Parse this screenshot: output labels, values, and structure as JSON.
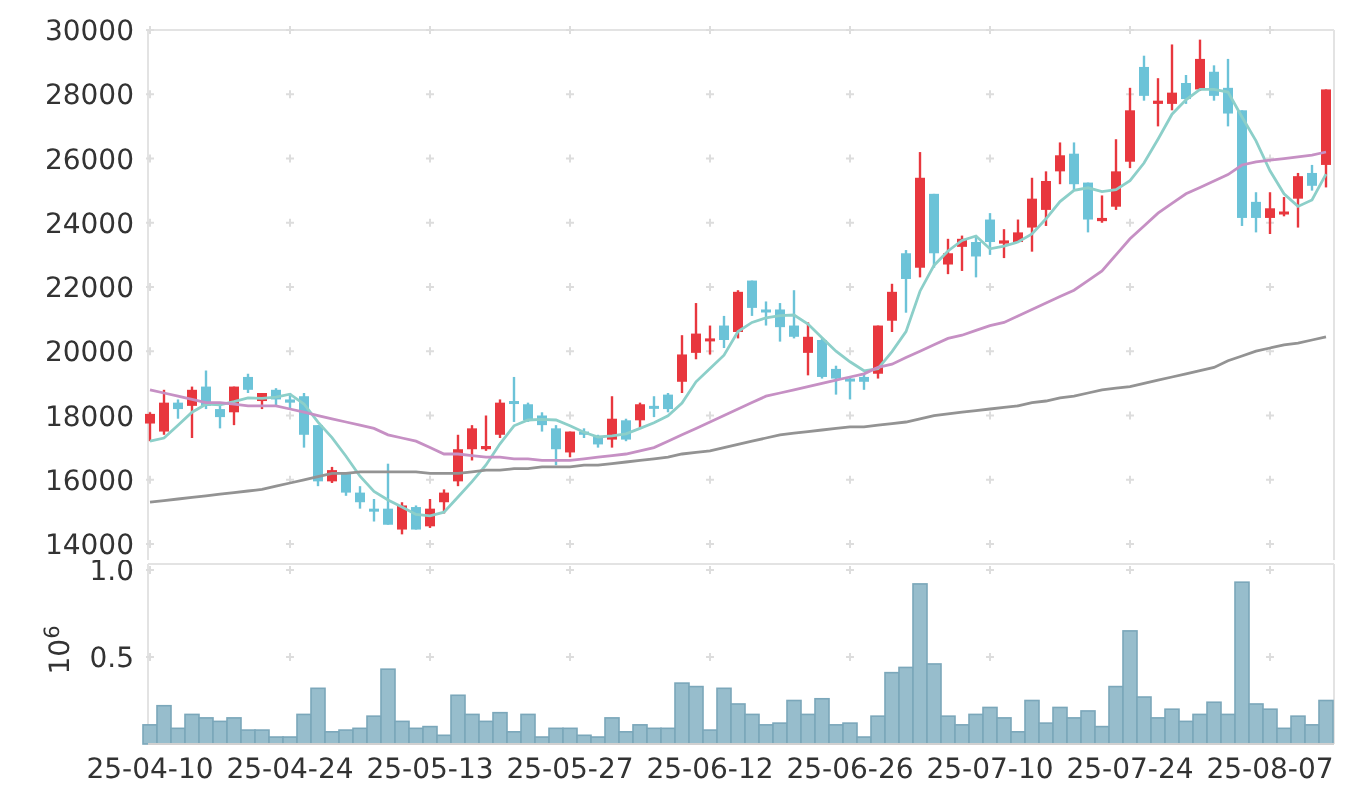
{
  "price_chart": {
    "chart_data": {
      "type": "candlestick",
      "grid": true,
      "ylim": [
        14000,
        30000
      ],
      "yticks": [
        14000,
        16000,
        18000,
        20000,
        22000,
        24000,
        26000,
        28000,
        30000
      ],
      "categories": [
        null,
        null,
        null,
        null,
        null,
        null,
        null,
        null,
        null,
        null,
        null,
        null,
        null,
        null,
        null,
        null,
        null,
        null,
        null,
        null,
        null,
        null,
        null,
        null,
        null,
        null,
        null,
        null,
        null,
        null,
        null,
        null,
        null,
        null,
        null,
        null,
        null,
        null,
        null,
        null,
        null,
        null,
        null,
        null,
        null,
        null,
        null,
        null,
        null,
        null,
        null,
        null,
        null,
        null,
        null,
        null,
        null,
        null,
        null,
        null,
        null,
        null,
        null,
        null,
        null,
        null,
        null,
        null,
        null,
        null,
        null,
        null,
        null,
        null,
        null,
        null,
        null,
        null,
        null,
        null,
        null,
        null,
        null,
        null,
        null
      ],
      "ohlc": [
        [
          17750,
          18100,
          17200,
          18050
        ],
        [
          17500,
          18800,
          17400,
          18400
        ],
        [
          18400,
          18500,
          17900,
          18200
        ],
        [
          18300,
          18900,
          17300,
          18800
        ],
        [
          18900,
          19400,
          18200,
          18300
        ],
        [
          18200,
          18400,
          17600,
          17950
        ],
        [
          18100,
          18900,
          17700,
          18900
        ],
        [
          19200,
          19300,
          18700,
          18800
        ],
        [
          18450,
          18700,
          18200,
          18700
        ],
        [
          18800,
          18850,
          18300,
          18500
        ],
        [
          18500,
          18700,
          18200,
          18400
        ],
        [
          18600,
          18700,
          17000,
          17400
        ],
        [
          17700,
          17700,
          15800,
          15950
        ],
        [
          15950,
          16400,
          15900,
          16300
        ],
        [
          16200,
          16200,
          15500,
          15600
        ],
        [
          15600,
          15800,
          15100,
          15300
        ],
        [
          15100,
          15400,
          14700,
          15050
        ],
        [
          15100,
          16500,
          14600,
          14600
        ],
        [
          14450,
          15300,
          14300,
          15200
        ],
        [
          15150,
          15200,
          14450,
          14450
        ],
        [
          14550,
          15400,
          14500,
          15100
        ],
        [
          15300,
          15700,
          14950,
          15600
        ],
        [
          15950,
          17400,
          15800,
          16950
        ],
        [
          16950,
          17700,
          16600,
          17600
        ],
        [
          16950,
          18000,
          16900,
          17050
        ],
        [
          17400,
          18500,
          17300,
          18400
        ],
        [
          18450,
          19200,
          17800,
          18400
        ],
        [
          18350,
          18400,
          17800,
          17850
        ],
        [
          18000,
          18100,
          17500,
          17700
        ],
        [
          17600,
          17700,
          16450,
          16950
        ],
        [
          16850,
          17500,
          16700,
          17500
        ],
        [
          17500,
          17600,
          17300,
          17400
        ],
        [
          17350,
          17400,
          17000,
          17100
        ],
        [
          17250,
          18600,
          17000,
          17900
        ],
        [
          17850,
          17900,
          17200,
          17250
        ],
        [
          17850,
          18400,
          17600,
          18350
        ],
        [
          18300,
          18600,
          17950,
          18250
        ],
        [
          18650,
          18700,
          18100,
          18200
        ],
        [
          19050,
          20500,
          18700,
          19900
        ],
        [
          19950,
          21500,
          19750,
          20550
        ],
        [
          20350,
          20800,
          19900,
          20400
        ],
        [
          20800,
          21100,
          20100,
          20350
        ],
        [
          20600,
          21900,
          20400,
          21850
        ],
        [
          22200,
          22200,
          21100,
          21350
        ],
        [
          21300,
          21550,
          20800,
          21250
        ],
        [
          21300,
          21500,
          20300,
          20750
        ],
        [
          20800,
          21900,
          20400,
          20450
        ],
        [
          19950,
          20900,
          19250,
          20450
        ],
        [
          20350,
          20400,
          19150,
          19200
        ],
        [
          19450,
          19550,
          18650,
          19150
        ],
        [
          19150,
          19200,
          18500,
          19100
        ],
        [
          19200,
          19300,
          18800,
          19050
        ],
        [
          19300,
          20800,
          19150,
          20800
        ],
        [
          20950,
          22100,
          20600,
          21850
        ],
        [
          23050,
          23150,
          21200,
          22250
        ],
        [
          22600,
          26200,
          22300,
          25400
        ],
        [
          24900,
          24900,
          22600,
          23050
        ],
        [
          22700,
          23500,
          22400,
          23050
        ],
        [
          23250,
          23600,
          22500,
          23500
        ],
        [
          23400,
          23600,
          22300,
          22950
        ],
        [
          24100,
          24300,
          23000,
          23400
        ],
        [
          23350,
          23800,
          22900,
          23450
        ],
        [
          23400,
          24100,
          23400,
          23700
        ],
        [
          23850,
          25400,
          23100,
          24750
        ],
        [
          24400,
          25600,
          23900,
          25300
        ],
        [
          25600,
          26500,
          25200,
          26100
        ],
        [
          26150,
          26500,
          25000,
          25200
        ],
        [
          25250,
          25250,
          23700,
          24100
        ],
        [
          24050,
          24850,
          24000,
          24150
        ],
        [
          24500,
          26600,
          24400,
          25600
        ],
        [
          25900,
          28200,
          25700,
          27500
        ],
        [
          28850,
          29200,
          27800,
          27950
        ],
        [
          27700,
          28500,
          27000,
          27800
        ],
        [
          27700,
          29550,
          27500,
          28050
        ],
        [
          28350,
          28600,
          27700,
          27850
        ],
        [
          28150,
          29700,
          28100,
          29100
        ],
        [
          28700,
          28900,
          27800,
          27950
        ],
        [
          28200,
          29100,
          27000,
          27400
        ],
        [
          27500,
          27500,
          23900,
          24150
        ],
        [
          24650,
          24950,
          23700,
          24150
        ],
        [
          24150,
          24950,
          23650,
          24450
        ],
        [
          24300,
          24800,
          24200,
          24350
        ],
        [
          24750,
          25550,
          23850,
          25450
        ],
        [
          25550,
          25800,
          25000,
          25150
        ],
        [
          25800,
          28150,
          25100,
          28150
        ]
      ],
      "series": [
        {
          "type": "line",
          "color": "#8ccfc9",
          "values": [
            17200,
            17300,
            17700,
            18100,
            18350,
            18330,
            18430,
            18550,
            18530,
            18570,
            18660,
            18360,
            17790,
            17310,
            16730,
            16110,
            15640,
            15370,
            15150,
            14920,
            14880,
            14990,
            15460,
            15940,
            16460,
            17120,
            17680,
            17860,
            17880,
            17860,
            17680,
            17480,
            17330,
            17370,
            17430,
            17600,
            17770,
            17990,
            18390,
            19050,
            19460,
            19880,
            20610,
            20900,
            21040,
            21110,
            21130,
            20850,
            20420,
            20000,
            19670,
            19390,
            19460,
            19990,
            20610,
            21870,
            22670,
            23120,
            23450,
            23590,
            23190,
            23270,
            23400,
            23650,
            24120,
            24660,
            25010,
            25090,
            24970,
            25030,
            25310,
            25860,
            26600,
            27380,
            27830,
            28150,
            28150,
            28070,
            27290,
            26550,
            25620,
            24900,
            24510,
            24710,
            25510
          ]
        },
        {
          "type": "line",
          "color": "#c690c4",
          "values": [
            18800,
            18700,
            18600,
            18500,
            18400,
            18400,
            18350,
            18300,
            18300,
            18300,
            18200,
            18100,
            18000,
            17900,
            17800,
            17700,
            17600,
            17400,
            17300,
            17200,
            17000,
            16800,
            16800,
            16750,
            16700,
            16700,
            16650,
            16650,
            16600,
            16600,
            16600,
            16650,
            16700,
            16750,
            16800,
            16900,
            17000,
            17200,
            17400,
            17600,
            17800,
            18000,
            18200,
            18400,
            18600,
            18700,
            18800,
            18900,
            19000,
            19100,
            19200,
            19300,
            19500,
            19600,
            19800,
            20000,
            20200,
            20400,
            20500,
            20650,
            20800,
            20900,
            21100,
            21300,
            21500,
            21700,
            21900,
            22200,
            22500,
            23000,
            23500,
            23900,
            24300,
            24600,
            24900,
            25100,
            25300,
            25500,
            25800,
            25900,
            25950,
            26000,
            26050,
            26100,
            26200
          ]
        },
        {
          "type": "line",
          "color": "#939393",
          "values": [
            15300,
            15350,
            15400,
            15450,
            15500,
            15550,
            15600,
            15650,
            15700,
            15800,
            15900,
            16000,
            16100,
            16200,
            16200,
            16250,
            16250,
            16250,
            16250,
            16250,
            16200,
            16200,
            16200,
            16250,
            16300,
            16300,
            16350,
            16350,
            16400,
            16400,
            16400,
            16450,
            16450,
            16500,
            16550,
            16600,
            16650,
            16700,
            16800,
            16850,
            16900,
            17000,
            17100,
            17200,
            17300,
            17400,
            17450,
            17500,
            17550,
            17600,
            17650,
            17650,
            17700,
            17750,
            17800,
            17900,
            18000,
            18050,
            18100,
            18150,
            18200,
            18250,
            18300,
            18400,
            18450,
            18550,
            18600,
            18700,
            18800,
            18850,
            18900,
            19000,
            19100,
            19200,
            19300,
            19400,
            19500,
            19700,
            19850,
            20000,
            20100,
            20200,
            20250,
            20350,
            20450
          ]
        }
      ]
    }
  },
  "volume_chart": {
    "chart_data": {
      "type": "bar",
      "ylabel": "10$^{6}$",
      "ylim": [
        0,
        1
      ],
      "yticks": [
        0.5,
        {
          "value": 1,
          "label": "1.0"
        }
      ],
      "categories": [
        "25-04-10",
        null,
        null,
        null,
        null,
        null,
        null,
        null,
        null,
        null,
        "25-04-24",
        null,
        null,
        null,
        null,
        null,
        null,
        null,
        null,
        null,
        "25-05-13",
        null,
        null,
        null,
        null,
        null,
        null,
        null,
        null,
        null,
        "25-05-27",
        null,
        null,
        null,
        null,
        null,
        null,
        null,
        null,
        null,
        "25-06-12",
        null,
        null,
        null,
        null,
        null,
        null,
        null,
        null,
        null,
        "25-06-26",
        null,
        null,
        null,
        null,
        null,
        null,
        null,
        null,
        null,
        "25-07-10",
        null,
        null,
        null,
        null,
        null,
        null,
        null,
        null,
        null,
        "25-07-24",
        null,
        null,
        null,
        null,
        null,
        null,
        null,
        null,
        null,
        "25-08-07",
        null,
        null,
        null,
        null
      ],
      "series": [
        {
          "color": "#97bdcc",
          "values": [
            0.11,
            0.22,
            0.09,
            0.17,
            0.15,
            0.13,
            0.15,
            0.08,
            0.08,
            0.04,
            0.04,
            0.17,
            0.32,
            0.07,
            0.08,
            0.09,
            0.16,
            0.43,
            0.13,
            0.09,
            0.1,
            0.05,
            0.28,
            0.17,
            0.13,
            0.18,
            0.07,
            0.17,
            0.04,
            0.09,
            0.09,
            0.05,
            0.04,
            0.15,
            0.07,
            0.11,
            0.09,
            0.09,
            0.35,
            0.33,
            0.08,
            0.32,
            0.23,
            0.17,
            0.11,
            0.12,
            0.25,
            0.17,
            0.26,
            0.11,
            0.12,
            0.04,
            0.16,
            0.41,
            0.44,
            0.92,
            0.46,
            0.16,
            0.11,
            0.17,
            0.21,
            0.15,
            0.07,
            0.25,
            0.12,
            0.21,
            0.15,
            0.19,
            0.1,
            0.33,
            0.65,
            0.27,
            0.15,
            0.2,
            0.13,
            0.17,
            0.24,
            0.17,
            0.93,
            0.23,
            0.2,
            0.09,
            0.16,
            0.11,
            0.25
          ]
        }
      ]
    }
  }
}
